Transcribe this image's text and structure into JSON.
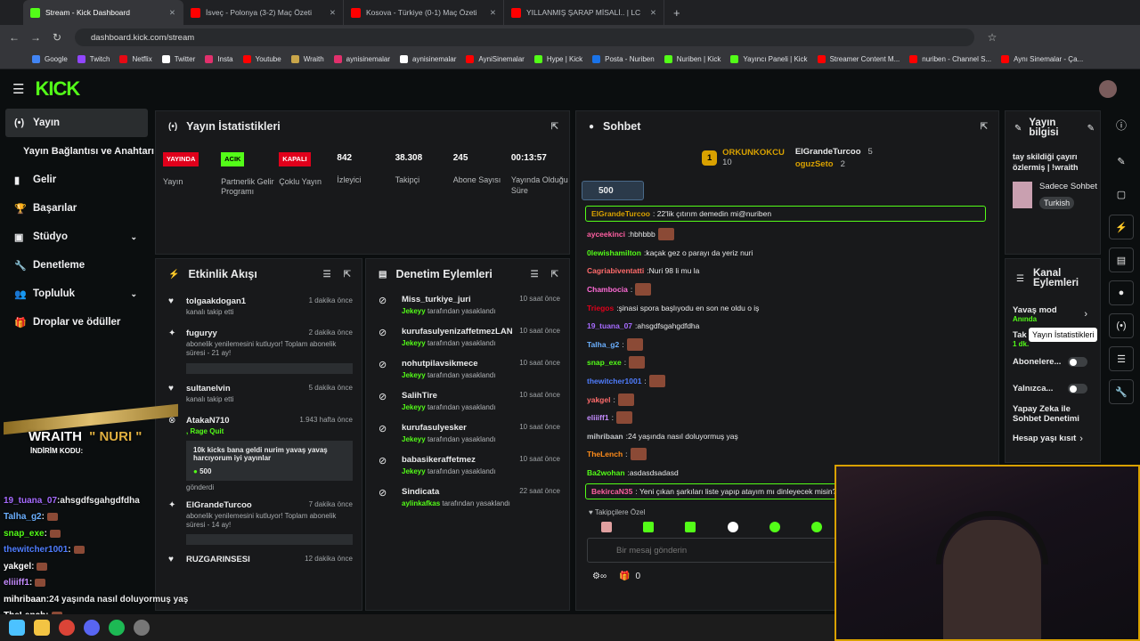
{
  "browser": {
    "tabs": [
      {
        "title": "Stream - Kick Dashboard",
        "color": "#53fc18",
        "active": true
      },
      {
        "title": "İsveç - Polonya (3-2) Maç Özeti",
        "color": "#ff0000"
      },
      {
        "title": "Kosova - Türkiye (0-1) Maç Özeti",
        "color": "#ff0000"
      },
      {
        "title": "YILLANMIŞ ŞARAP MİSALİ.. | LC",
        "color": "#ff0000"
      }
    ],
    "url": "dashboard.kick.com/stream",
    "bookmarks": [
      {
        "label": "Google",
        "color": "#4285f4"
      },
      {
        "label": "Twitch",
        "color": "#9146ff"
      },
      {
        "label": "Netflix",
        "color": "#e50914"
      },
      {
        "label": "Twitter",
        "color": "#ffffff"
      },
      {
        "label": "Insta",
        "color": "#e1306c"
      },
      {
        "label": "Youtube",
        "color": "#ff0000"
      },
      {
        "label": "Wraith",
        "color": "#c9a64a"
      },
      {
        "label": "aynisinemalar",
        "color": "#e1306c"
      },
      {
        "label": "aynisinemalar",
        "color": "#ffffff"
      },
      {
        "label": "AyniSinemalar",
        "color": "#ff0000"
      },
      {
        "label": "Hype | Kick",
        "color": "#53fc18"
      },
      {
        "label": "Posta - Nuriben",
        "color": "#1a73e8"
      },
      {
        "label": "Nuriben | Kick",
        "color": "#53fc18"
      },
      {
        "label": "Yayıncı Paneli | Kick",
        "color": "#53fc18"
      },
      {
        "label": "Streamer Content M...",
        "color": "#ff0000"
      },
      {
        "label": "nuriben - Channel S...",
        "color": "#ff0000"
      },
      {
        "label": "Aynı Sinemalar - Ça...",
        "color": "#ff0000"
      }
    ]
  },
  "kick": {
    "logo": "KICK"
  },
  "sidebar": {
    "items": [
      {
        "label": "Yayın",
        "icon": "broadcast-icon",
        "glyph": "(•)",
        "active": true
      },
      {
        "label": "Yayın Bağlantısı ve Anahtarı",
        "icon": "",
        "glyph": ""
      },
      {
        "label": "Gelir",
        "icon": "chart-icon",
        "glyph": "▮"
      },
      {
        "label": "Başarılar",
        "icon": "trophy-icon",
        "glyph": "🏆"
      },
      {
        "label": "Stüdyo",
        "icon": "studio-icon",
        "glyph": "▣",
        "chevron": true
      },
      {
        "label": "Denetleme",
        "icon": "wrench-icon",
        "glyph": "🔧"
      },
      {
        "label": "Topluluk",
        "icon": "community-icon",
        "glyph": "👥",
        "chevron": true
      },
      {
        "label": "Droplar ve ödüller",
        "icon": "gift-icon",
        "glyph": "🎁"
      }
    ]
  },
  "stats": {
    "title": "Yayın İstatistikleri",
    "items": [
      {
        "badge": "YAYINDA",
        "badge_color": "#e0001b",
        "label": "Yayın"
      },
      {
        "badge": "ACIK",
        "badge_color": "#53fc18",
        "label": "Partnerlik Gelir Programı"
      },
      {
        "badge": "KAPALI",
        "badge_color": "#e0001b",
        "label": "Çoklu Yayın"
      },
      {
        "value": "842",
        "label": "İzleyici"
      },
      {
        "value": "38.308",
        "label": "Takipçi"
      },
      {
        "value": "245",
        "label": "Abone Sayısı"
      },
      {
        "value": "00:13:57",
        "label": "Yayında Olduğu Süre"
      }
    ]
  },
  "activity": {
    "title": "Etkinlik Akışı",
    "items": [
      {
        "user": "tolgaakdogan1",
        "time": "1 dakika önce",
        "text": "kanalı takip etti",
        "icon": "heart-icon",
        "glyph": "♥"
      },
      {
        "user": "fuguryy",
        "time": "2 dakika önce",
        "text": "abonelik yenilemesini kutluyor! Toplam abonelik süresi - 21 ay!",
        "icon": "star-icon",
        "glyph": "✦",
        "box": " "
      },
      {
        "user": "sultanelvin",
        "time": "5 dakika önce",
        "text": "kanalı takip etti",
        "icon": "heart-icon",
        "glyph": "♥"
      },
      {
        "user": "AtakaN710",
        "time": "1.943 hafta önce",
        "text": ", Rage Quit",
        "icon": "kick-coin-icon",
        "glyph": "⊗",
        "box": "10k kicks bana geldi nurim yavaş yavaş harcıyorum iyi yayınlar",
        "amount": "500",
        "footer": "gönderdi"
      },
      {
        "user": "ElGrandeTurcoo",
        "time": "7 dakika önce",
        "text": "abonelik yenilemesini kutluyor! Toplam abonelik süresi - 14 ay!",
        "icon": "star-icon",
        "glyph": "✦",
        "box": " "
      },
      {
        "user": "RUZGARINSESI",
        "time": "12 dakika önce",
        "text": "",
        "icon": "heart-icon",
        "glyph": "♥"
      }
    ]
  },
  "moderation": {
    "title": "Denetim Eylemleri",
    "mod": "Jekeyy",
    "suffix": "tarafından yasaklandı",
    "items": [
      {
        "user": "Miss_turkiye_juri",
        "time": "10 saat önce",
        "mod": "Jekeyy"
      },
      {
        "user": "kurufasulyenizaffetmezLAN",
        "time": "10 saat önce",
        "mod": "Jekeyy"
      },
      {
        "user": "nohutpilavsikmece",
        "time": "10 saat önce",
        "mod": "Jekeyy"
      },
      {
        "user": "SalihTire",
        "time": "10 saat önce",
        "mod": "Jekeyy"
      },
      {
        "user": "kurufasulyesker",
        "time": "10 saat önce",
        "mod": "Jekeyy"
      },
      {
        "user": "babasikeraffetmez",
        "time": "10 saat önce",
        "mod": "Jekeyy"
      },
      {
        "user": "Sindicata",
        "time": "22 saat önce",
        "mod": "aylinkafkas"
      }
    ]
  },
  "chat": {
    "title": "Sohbet",
    "leaderboard": [
      {
        "rank": "1",
        "user": "ORKUNKOKCU",
        "score": "10"
      },
      {
        "user": "ElGrandeTurcoo",
        "score": "5"
      },
      {
        "user": "oguzSeto",
        "score": "2"
      }
    ],
    "kicks_goal": "500",
    "pinned": {
      "user": "ElGrandeTurcoo",
      "text": "22'lik çıtırım demedin mi@nuriben"
    },
    "messages": [
      {
        "user": "ayceekinci",
        "color": "#ff5fa2",
        "text": "hbhbbb",
        "emote": true
      },
      {
        "user": "0lewishamilton",
        "color": "#53fc18",
        "text": "kaçak gez o parayı da yeriz nuri"
      },
      {
        "user": "Cagriabiventatti",
        "color": "#ff6b6b",
        "text": "Nuri 98 li mu la"
      },
      {
        "user": "Chambocia",
        "color": "#ff6bd6",
        "text": "",
        "emote": true
      },
      {
        "user": "Triegos",
        "color": "#e0001b",
        "text": "şinasi spora başlıyodu en son ne oldu o iş"
      },
      {
        "user": "19_tuana_07",
        "color": "#a66bff",
        "text": "ahsgdfsgahgdfdha"
      },
      {
        "user": "Talha_g2",
        "color": "#6bb0ff",
        "text": "",
        "emote": true
      },
      {
        "user": "snap_exe",
        "color": "#53fc18",
        "text": "",
        "emote": true
      },
      {
        "user": "thewitcher1001",
        "color": "#4f7dff",
        "text": "",
        "emote": true
      },
      {
        "user": "yakgel",
        "color": "#ff6b6b",
        "text": "",
        "emote": true
      },
      {
        "user": "eliiiff1",
        "color": "#c58cff",
        "text": "",
        "emote": true
      },
      {
        "user": "mihribaan",
        "color": "#c4c7ca",
        "text": "24 yaşında nasıl doluyormuş yaş"
      },
      {
        "user": "TheLench",
        "color": "#ff8c1a",
        "text": "",
        "emote": true
      },
      {
        "user": "Ba2wohan",
        "color": "#53fc18",
        "text": "asdasdsadasd"
      }
    ],
    "pinned2": {
      "user": "BekircaN35",
      "text": "Yeni çıkan şarkıları liste yapıp atayım mı dinleyecek misin?"
    },
    "followers_only": "Takipçilere Özel",
    "input_placeholder": "Bir mesaj gönderin",
    "bottom_count": "0"
  },
  "stream_info": {
    "title": "Yayın bilgisi",
    "stream_title": "tay skildiği çayırı özlermiş | !wraith",
    "category": "Sadece Sohbet",
    "language": "Turkish"
  },
  "channel_actions": {
    "title": "Kanal Eylemleri",
    "slow_mode": "Yavaş mod",
    "slow_mode_sub": "Anında",
    "follower": "Tak",
    "follower_sub": "1 dk.",
    "subscribers": "Abonelere...",
    "only": "Yalnızca...",
    "ai": "Yapay Zeka ile Sohbet Denetimi",
    "age": "Hesap yaşı kısıt"
  },
  "tooltip": "Yayın İstatistikleri",
  "overlay_chat": [
    {
      "user": "19_tuana_07",
      "text": "ahsgdfsgahgdfdha",
      "color": "#a66bff"
    },
    {
      "user": "Talha_g2",
      "text": "",
      "color": "#6bb0ff"
    },
    {
      "user": "snap_exe",
      "text": "",
      "color": "#53fc18"
    },
    {
      "user": "thewitcher1001",
      "text": "",
      "color": "#4f7dff"
    },
    {
      "user": "yakgel",
      "text": "",
      "color": "#ffffff"
    },
    {
      "user": "eliiiff1",
      "text": "",
      "color": "#c58cff"
    },
    {
      "user": "mihribaan",
      "text": "24 yaşında nasıl doluyormuş yaş",
      "color": "#ffffff"
    },
    {
      "user": "TheLench",
      "text": "",
      "color": "#ffffff"
    }
  ],
  "promo": {
    "brand": "WRAITH",
    "code_label": "İNDİRİM KODU:",
    "code": "NURI"
  }
}
